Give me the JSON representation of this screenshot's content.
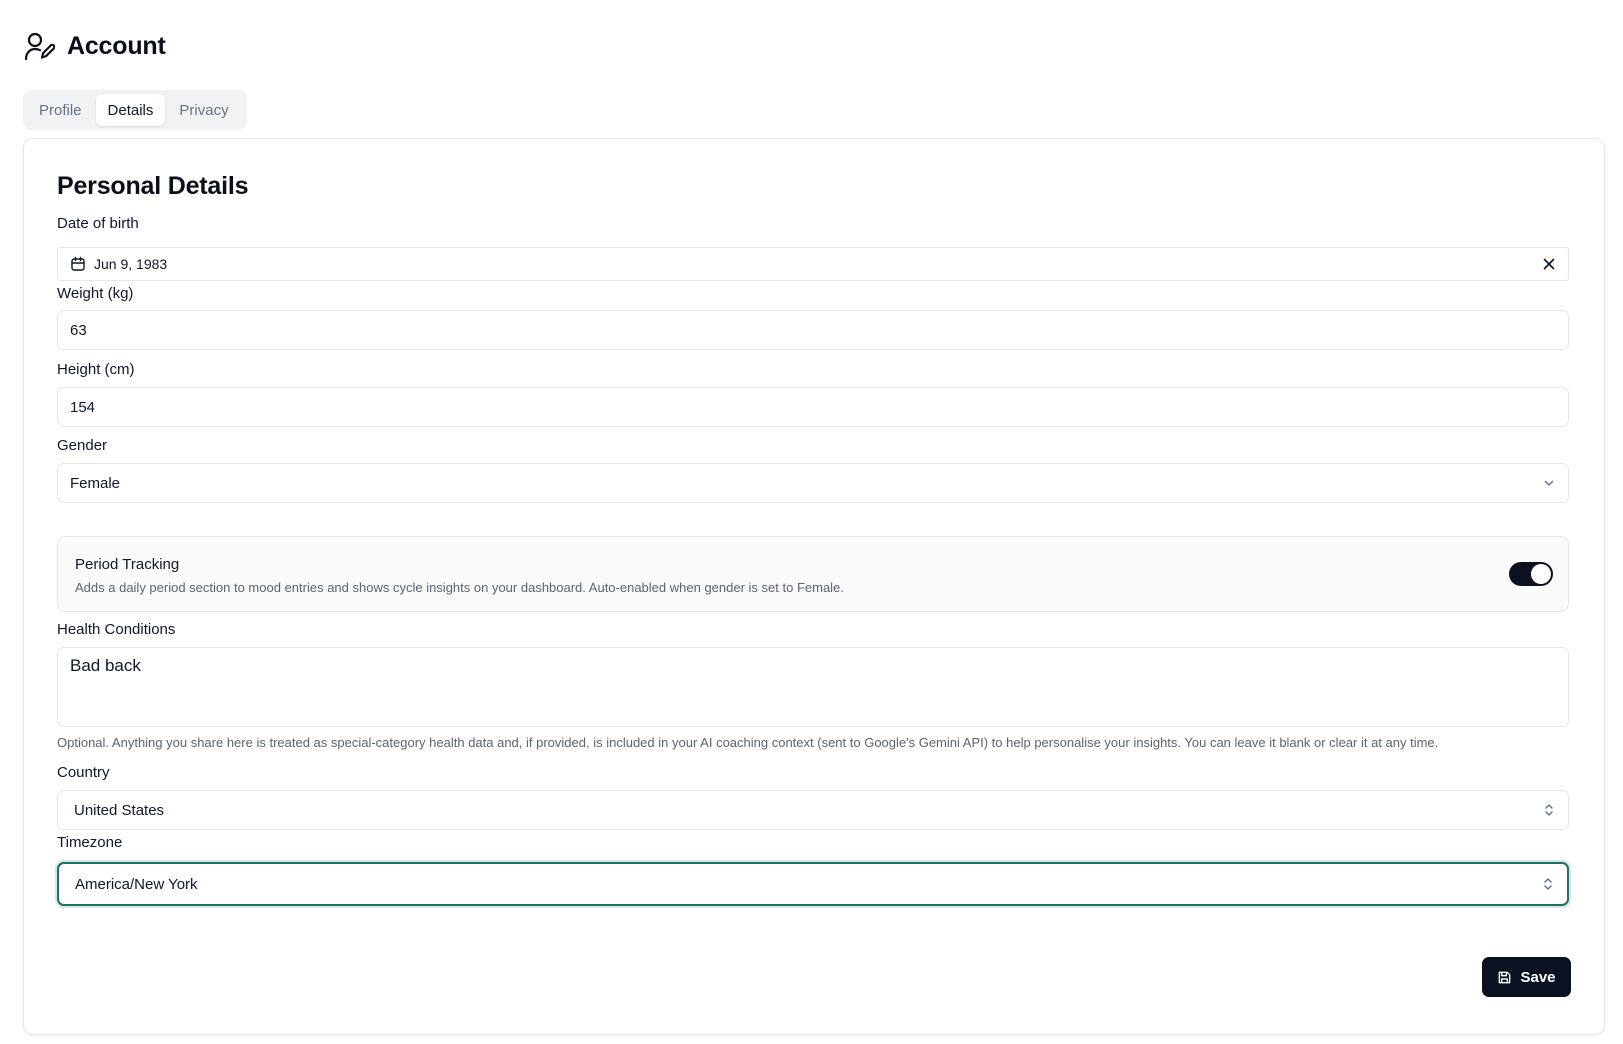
{
  "header": {
    "title": "Account",
    "icon": "user-edit-icon"
  },
  "tabs": [
    {
      "label": "Profile",
      "active": false
    },
    {
      "label": "Details",
      "active": true
    },
    {
      "label": "Privacy",
      "active": false
    }
  ],
  "card": {
    "title": "Personal Details",
    "fields": {
      "dob": {
        "label": "Date of birth",
        "value": "Jun 9, 1983",
        "icon": "calendar-icon",
        "clear_icon": "close-icon"
      },
      "weight": {
        "label": "Weight (kg)",
        "value": "63"
      },
      "height": {
        "label": "Height (cm)",
        "value": "154"
      },
      "gender": {
        "label": "Gender",
        "value": "Female",
        "icon": "chevron-down-icon"
      },
      "period": {
        "title": "Period Tracking",
        "description": "Adds a daily period section to mood entries and shows cycle insights on your dashboard. Auto-enabled when gender is set to Female.",
        "enabled": true
      },
      "health": {
        "label": "Health Conditions",
        "value": "Bad back",
        "help": "Optional. Anything you share here is treated as special-category health data and, if provided, is included in your AI coaching context (sent to Google's Gemini API) to help personalise your insights. You can leave it blank or clear it at any time."
      },
      "country": {
        "label": "Country",
        "value": "United States",
        "icon": "chevron-up-down-icon"
      },
      "timezone": {
        "label": "Timezone",
        "value": "America/New York",
        "icon": "chevron-up-down-icon",
        "focused": true
      }
    },
    "save_label": "Save",
    "save_icon": "floppy-disk-icon"
  },
  "colors": {
    "accent": "#0b1120",
    "focus_ring": "#1f6f6b",
    "border": "#e3e6ea"
  }
}
